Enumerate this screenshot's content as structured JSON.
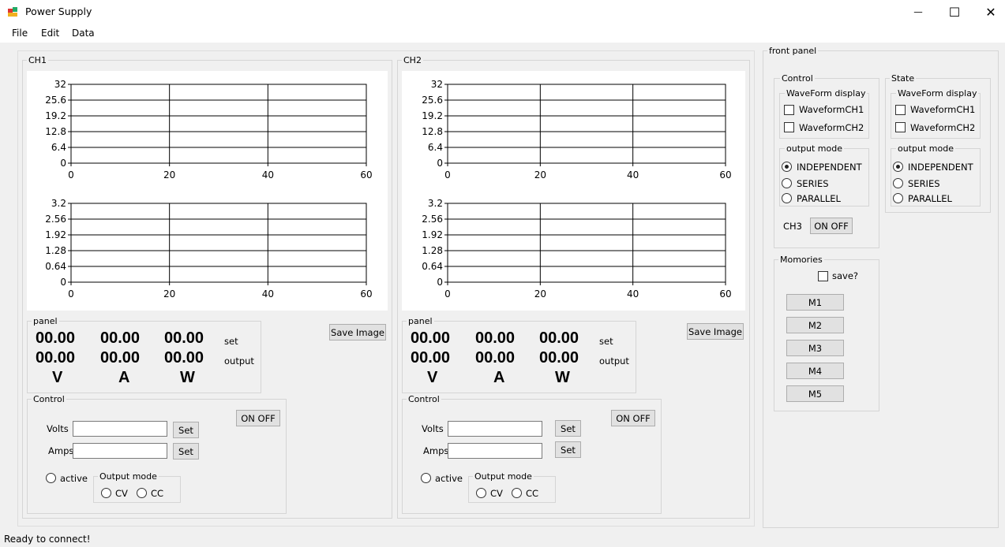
{
  "window": {
    "title": "Power Supply",
    "minimize": "—",
    "maximize": "☐",
    "close": "✕"
  },
  "menu": [
    "File",
    "Edit",
    "Data"
  ],
  "channels": [
    {
      "label": "CH1",
      "panel_label": "panel",
      "set_label": "set",
      "output_label": "output",
      "set": {
        "v": "00.00",
        "a": "00.00",
        "w": "00.00"
      },
      "output": {
        "v": "00.00",
        "a": "00.00",
        "w": "00.00"
      },
      "units": [
        "V",
        "A",
        "W"
      ],
      "save_image": "Save Image",
      "control": {
        "label": "Control",
        "on_off": "ON OFF",
        "volts_label": "Volts",
        "amps_label": "Amps",
        "volts_value": "",
        "amps_value": "",
        "set_label": "Set",
        "active_label": "active",
        "output_mode_label": "Output mode",
        "cv_label": "CV",
        "cc_label": "CC"
      }
    },
    {
      "label": "CH2",
      "panel_label": "panel",
      "set_label": "set",
      "output_label": "output",
      "set": {
        "v": "00.00",
        "a": "00.00",
        "w": "00.00"
      },
      "output": {
        "v": "00.00",
        "a": "00.00",
        "w": "00.00"
      },
      "units": [
        "V",
        "A",
        "W"
      ],
      "save_image": "Save Image",
      "control": {
        "label": "Control",
        "on_off": "ON OFF",
        "volts_label": "Volts",
        "amps_label": "Amps",
        "volts_value": "",
        "amps_value": "",
        "set_label": "Set",
        "active_label": "active",
        "output_mode_label": "Output mode",
        "cv_label": "CV",
        "cc_label": "CC"
      }
    }
  ],
  "chart_data": [
    {
      "type": "line",
      "x_ticks": [
        "0",
        "20",
        "40",
        "60"
      ],
      "y_ticks": [
        "32",
        "25.6",
        "19.2",
        "12.8",
        "6.4",
        "0"
      ],
      "xlim": [
        0,
        60
      ],
      "ylim": [
        0,
        32
      ],
      "grid": true
    },
    {
      "type": "line",
      "x_ticks": [
        "0",
        "20",
        "40",
        "60"
      ],
      "y_ticks": [
        "3.2",
        "2.56",
        "1.92",
        "1.28",
        "0.64",
        "0"
      ],
      "xlim": [
        0,
        60
      ],
      "ylim": [
        0,
        3.2
      ],
      "grid": true
    },
    {
      "type": "line",
      "x_ticks": [
        "0",
        "20",
        "40",
        "60"
      ],
      "y_ticks": [
        "32",
        "25.6",
        "19.2",
        "12.8",
        "6.4",
        "0"
      ],
      "xlim": [
        0,
        60
      ],
      "ylim": [
        0,
        32
      ],
      "grid": true
    },
    {
      "type": "line",
      "x_ticks": [
        "0",
        "20",
        "40",
        "60"
      ],
      "y_ticks": [
        "3.2",
        "2.56",
        "1.92",
        "1.28",
        "0.64",
        "0"
      ],
      "xlim": [
        0,
        60
      ],
      "ylim": [
        0,
        3.2
      ],
      "grid": true
    }
  ],
  "front_panel": {
    "label": "front panel",
    "control": {
      "label": "Control",
      "waveform_label": "WaveForm display",
      "wf_ch1": "WaveformCH1",
      "wf_ch2": "WaveformCH2",
      "output_mode_label": "output mode",
      "independent": "INDEPENDENT",
      "series": "SERIES",
      "parallel": "PARALLEL",
      "ch3_label": "CH3",
      "ch3_on_off": "ON OFF"
    },
    "state": {
      "label": "State",
      "waveform_label": "WaveForm display",
      "wf_ch1": "WaveformCH1",
      "wf_ch2": "WaveformCH2",
      "output_mode_label": "output mode",
      "independent": "INDEPENDENT",
      "series": "SERIES",
      "parallel": "PARALLEL"
    },
    "memories": {
      "label": "Momories",
      "save_label": "save?",
      "buttons": [
        "M1",
        "M2",
        "M3",
        "M4",
        "M5"
      ]
    }
  },
  "status": "Ready to connect!"
}
